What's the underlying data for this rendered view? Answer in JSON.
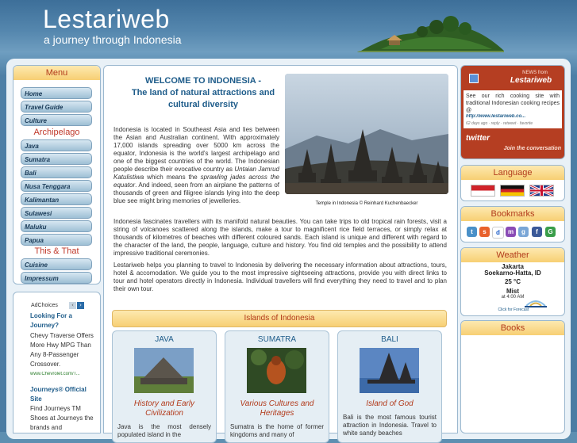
{
  "header": {
    "title": "Lestariweb",
    "tagline": "a journey through Indonesia"
  },
  "menu": {
    "title": "Menu",
    "items_top": [
      "Home",
      "Travel Guide",
      "Culture"
    ],
    "section_archipelago": "Archipelago",
    "items_archipelago": [
      "Java",
      "Sumatra",
      "Bali",
      "Nusa Tenggara",
      "Kalimantan",
      "Sulawesi",
      "Maluku",
      "Papua"
    ],
    "section_this": "This & That",
    "items_this": [
      "Cuisine",
      "Impressum"
    ]
  },
  "ads": {
    "adchoices": "AdChoices",
    "ad1_title": "Looking For a Journey?",
    "ad1_text": "Chevy Traverse Offers More Hwy MPG Than Any 8-Passenger Crossover.",
    "ad1_url": "www.Chevrolet.com/T...",
    "ad2_title": "Journeys® Official Site",
    "ad2_text": "Find Journeys TM Shoes at Journeys the brands and"
  },
  "main": {
    "welcome_line1": "WELCOME TO INDONESIA -",
    "welcome_line2": "The land of natural attractions and cultural diversity",
    "p1_a": "Indonesia is located in Southeast Asia and lies between the Asian and Australian continent. With approximately 17,000 islands spreading over 5000 km across the equator, Indonesia is the world's largest archipelago and one of the biggest countries of the world. The Indonesian people describe their evocative country as ",
    "p1_em1": "Untaian Jamrud Katulistiwa",
    "p1_b": " which means the ",
    "p1_em2": "sprawling jades across the equator",
    "p1_c": ". And indeed, seen from an airplane the patterns of thousands of green and filigree islands lying into the deep blue see might bring memories of jewelleries.",
    "p2": "Indonesia fascinates travellers with its manifold natural beauties. You can take trips to old tropical rain forests, visit a string of volcanoes scattered along the islands, make a tour to magnificent rice field terraces, or simply relax at thousands of kilometres of beaches with different coloured sands. Each island is unique and different with regard to the character of the land, the people, language, culture and history. You find old temples and the possibility to attend impressive traditional ceremonies.",
    "p3": "Lestariweb helps you planning to travel to Indonesia by delivering the necessary information about attractions, tours, hotel & accomodation. We guide you to the most impressive sightseeing attractions, provide you with direct links to tour and hotel operators directly in Indonesia. Individual travellers will find everything they need to travel and to plan their own tour.",
    "photo_caption": "Temple in Indonesia © Reinhard Kuchenbaecker",
    "islands_title": "Islands of Indonesia",
    "islands": [
      {
        "name": "JAVA",
        "heading": "History and Early Civilization",
        "text": "Java is the most densely populated island in the"
      },
      {
        "name": "SUMATRA",
        "heading": "Various Cultures and Heritages",
        "text": "Sumatra is the home of former kingdoms and many of"
      },
      {
        "name": "BALI",
        "heading": "Island of God",
        "text": "Bali is the most famous tourist attraction in Indonesia. Travel to white sandy beaches"
      }
    ]
  },
  "twitter": {
    "news_from": "NEWS from",
    "account": "Lestariweb",
    "tweet": "See our rich cooking site with traditional Indonesian cooking recipes @",
    "link": "http://www.lestariweb.co...",
    "meta": "62 days ago · reply · retweet · favorite",
    "brand": "twitter",
    "join": "Join the conversation"
  },
  "language": {
    "title": "Language"
  },
  "bookmarks": {
    "title": "Bookmarks"
  },
  "weather": {
    "title": "Weather",
    "city": "Jakarta",
    "station": "Soekarno-Hatta, ID",
    "temp": "25 °C",
    "cond": "Mist",
    "time": "at 4:00 AM",
    "forecast": "Click for Forecast"
  },
  "books": {
    "title": "Books"
  },
  "colors": {
    "accent": "#b23b1c",
    "link": "#1e5c8a",
    "header": "#4a7ca4"
  }
}
